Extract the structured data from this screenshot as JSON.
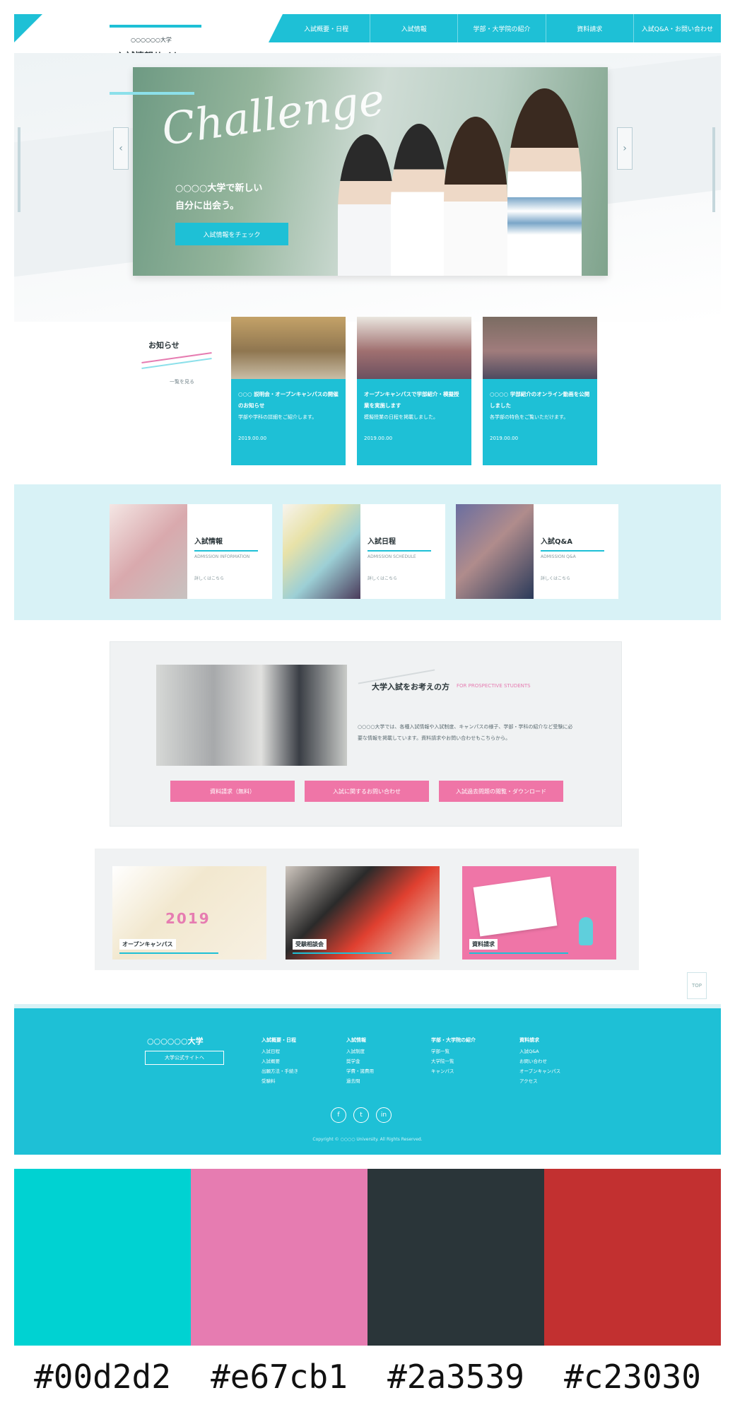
{
  "header": {
    "logo_small": "○○○○○○大学",
    "logo_main": "入試情報サイト",
    "nav": [
      "入試概要・日程",
      "入試情報",
      "学部・大学院の紹介",
      "資料請求",
      "入試Q&A・お問い合わせ"
    ]
  },
  "hero": {
    "script_text": "Challenge",
    "copy_line1": "○○○○大学で新しい",
    "copy_line2": "自分に出会う。",
    "button_label": "入試情報をチェック"
  },
  "news": {
    "title": "お知らせ",
    "more": "一覧を見る",
    "items": [
      {
        "title": "○○○ 説明会・オープンキャンパスの開催のお知らせ",
        "body": "学部や学科の詳細をご紹介します。",
        "date": "2019.00.00"
      },
      {
        "title": "オープンキャンパスで学部紹介・模擬授業を実施します",
        "body": "模擬授業の日程を掲載しました。",
        "date": "2019.00.00"
      },
      {
        "title": "○○○○ 学部紹介のオンライン動画を公開しました",
        "body": "各学部の特色をご覧いただけます。",
        "date": "2019.00.00"
      }
    ]
  },
  "features": [
    {
      "title": "入試情報",
      "sub": "ADMISSION INFORMATION",
      "more": "詳しくはこちら"
    },
    {
      "title": "入試日程",
      "sub": "ADMISSION SCHEDULE",
      "more": "詳しくはこちら"
    },
    {
      "title": "入試Q&A",
      "sub": "ADMISSION Q&A",
      "more": "詳しくはこちら"
    }
  ],
  "info": {
    "title": "大学入試をお考えの方",
    "title_sub": "FOR PROSPECTIVE STUDENTS",
    "body": "○○○○大学では、各種入試情報や入試制度、キャンパスの様子、学部・学科の紹介など受験に必要な情報を掲載しています。資料請求やお問い合わせもこちらから。",
    "buttons": [
      "資料請求（無料）",
      "入試に関するお問い合わせ",
      "入試過去問題の閲覧・ダウンロード"
    ]
  },
  "banners": {
    "b1_year": "2019",
    "b1_caption": "オープンキャンパス",
    "b2_caption": "受験相談会",
    "b3_caption": "資料請求"
  },
  "pagetop": "TOP",
  "footer": {
    "logo": "○○○○○○大学",
    "logo_button": "大学公式サイトへ",
    "columns": [
      {
        "heading": "入試概要・日程",
        "links": [
          "入試日程",
          "入試概要",
          "出願方法・手続き",
          "受験料"
        ]
      },
      {
        "heading": "入試情報",
        "links": [
          "入試制度",
          "奨学金",
          "学費・諸費用",
          "過去問"
        ]
      },
      {
        "heading": "学部・大学院の紹介",
        "links": [
          "学部一覧",
          "大学院一覧",
          "キャンパス"
        ]
      },
      {
        "heading": "資料請求",
        "links": [
          "入試Q&A",
          "お問い合わせ",
          "オープンキャンパス",
          "アクセス"
        ]
      }
    ],
    "sns": [
      "f",
      "t",
      "in"
    ],
    "copyright": "Copyright © ○○○○ University. All Rights Reserved."
  },
  "palette": {
    "colors": [
      "#00d2d2",
      "#e67cb1",
      "#2a3539",
      "#c23030"
    ],
    "labels": [
      "#00d2d2",
      "#e67cb1",
      "#2a3539",
      "#c23030"
    ]
  }
}
